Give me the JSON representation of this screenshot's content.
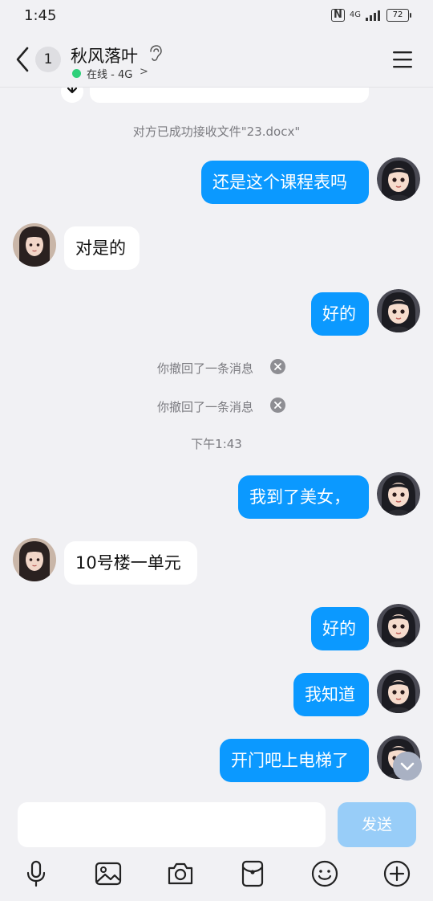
{
  "status_bar": {
    "time": "1:45",
    "nfc": "N",
    "network": "4G",
    "battery": "72"
  },
  "header": {
    "back_label": "<",
    "unread_count": "1",
    "contact_name": "秋风落叶",
    "online_status": "在线 - 4G",
    "status_chevron": ">"
  },
  "messages": {
    "file_received": "对方已成功接收文件\"23.docx\"",
    "m1": "还是这个课程表吗",
    "m2": "对是的",
    "m3": "好的",
    "recall1": "你撤回了一条消息",
    "recall2": "你撤回了一条消息",
    "time_divider": "下午1:43",
    "m4": "我到了美女，",
    "m5": "10号楼一单元",
    "m6": "好的",
    "m7": "我知道",
    "m8": "开门吧上电梯了"
  },
  "composer": {
    "input_value": "",
    "send_label": "发送"
  },
  "toolbar": {
    "icons": [
      "microphone-icon",
      "image-icon",
      "camera-icon",
      "red-packet-icon",
      "emoji-icon",
      "plus-icon"
    ]
  },
  "colors": {
    "outgoing_bubble": "#0b99ff",
    "incoming_bubble": "#ffffff",
    "background": "#f1f1f4",
    "send_button": "#98cdf8",
    "online_dot": "#2fd07a"
  }
}
